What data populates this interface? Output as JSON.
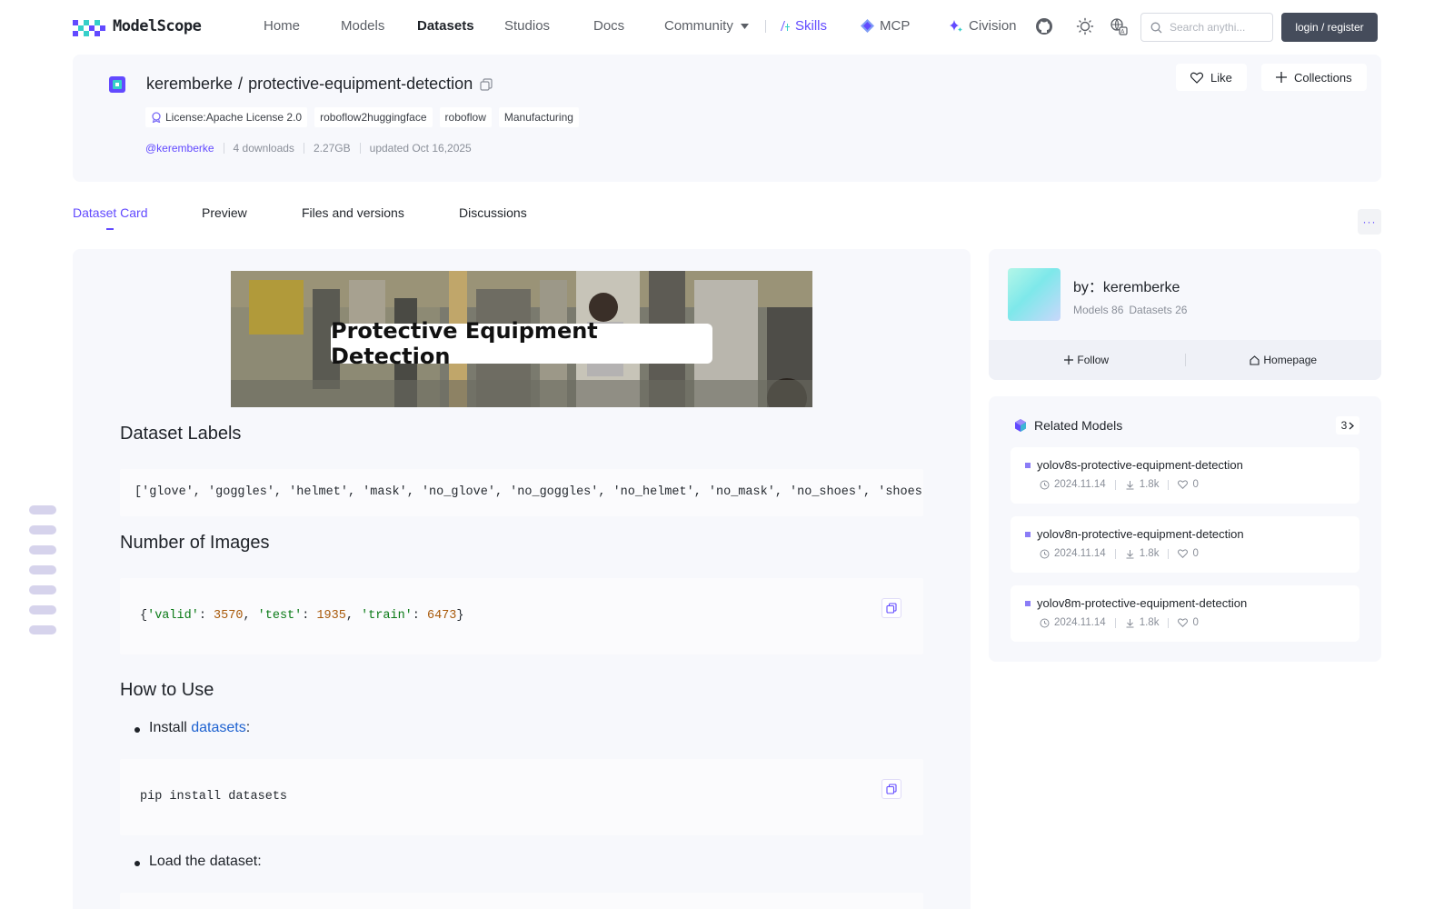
{
  "nav": {
    "logo_text": "ModelScope",
    "items": [
      {
        "label": "Home"
      },
      {
        "label": "Models"
      },
      {
        "label": "Datasets"
      },
      {
        "label": "Studios"
      },
      {
        "label": "Docs"
      },
      {
        "label": "Community"
      }
    ],
    "skills_label": "Skills",
    "mcp_label": "MCP",
    "civision_label": "Civision",
    "search_placeholder": "Search anythi...",
    "login_label": "login / register",
    "accent": "#624aff"
  },
  "dataset": {
    "owner": "keremberke",
    "slash": "/",
    "name": "protective-equipment-detection",
    "tags": [
      "License:Apache License 2.0",
      "roboflow2huggingface",
      "roboflow",
      "Manufacturing"
    ],
    "author_handle": "@keremberke",
    "downloads": "4 downloads",
    "size": "2.27GB",
    "updated": "updated Oct 16,2025",
    "like_label": "Like",
    "collections_label": "Collections"
  },
  "tabs": [
    "Dataset Card",
    "Preview",
    "Files and versions",
    "Discussions"
  ],
  "more_label": "···",
  "card": {
    "banner_text": "Protective Equipment Detection",
    "labels_heading": "Dataset Labels",
    "labels_code": "['glove', 'goggles', 'helmet', 'mask', 'no_glove', 'no_goggles', 'no_helmet', 'no_mask', 'no_shoes', 'shoes']",
    "images_heading": "Number of Images",
    "images": {
      "open": "{",
      "k1": "'valid'",
      "v1": "3570",
      "k2": "'test'",
      "v2": "1935",
      "k3": "'train'",
      "v3": "6473",
      "close": "}",
      "colon": ": ",
      "comma": ", "
    },
    "howto_heading": "How to Use",
    "install_prefix": "Install",
    "install_link": "datasets",
    "install_suffix": ":",
    "pip_code": "pip install datasets",
    "load_label": "Load the dataset:"
  },
  "author": {
    "by_label": "by：keremberke",
    "models": "Models 86",
    "datasets": "Datasets 26",
    "follow_label": "Follow",
    "homepage_label": "Homepage"
  },
  "related": {
    "heading": "Related Models",
    "count": "3",
    "items": [
      {
        "name": "yolov8s-protective-equipment-detection",
        "date": "2024.11.14",
        "downloads": "1.8k",
        "likes": "0"
      },
      {
        "name": "yolov8n-protective-equipment-detection",
        "date": "2024.11.14",
        "downloads": "1.8k",
        "likes": "0"
      },
      {
        "name": "yolov8m-protective-equipment-detection",
        "date": "2024.11.14",
        "downloads": "1.8k",
        "likes": "0"
      }
    ]
  }
}
